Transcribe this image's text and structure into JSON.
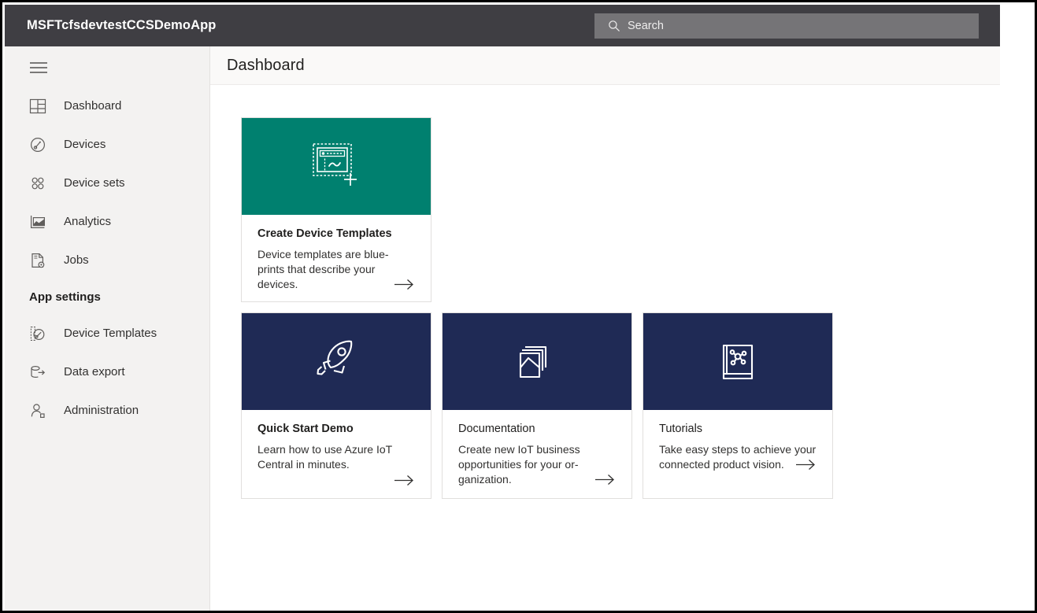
{
  "topbar": {
    "app_title": "MSFTcfsdevtestCCSDemoApp",
    "search_placeholder": "Search",
    "search_value": "",
    "background_color": "#3f3e43",
    "search_background_color": "#757477"
  },
  "sidebar": {
    "menu_toggle_name": "hamburger-menu",
    "background_color": "#f3f2f1",
    "items": [
      {
        "label": "Dashboard",
        "icon": "dashboard-grid-icon"
      },
      {
        "label": "Devices",
        "icon": "device-gauge-icon"
      },
      {
        "label": "Device sets",
        "icon": "device-sets-circles-icon"
      },
      {
        "label": "Analytics",
        "icon": "analytics-chart-icon"
      },
      {
        "label": "Jobs",
        "icon": "jobs-document-gear-icon"
      }
    ],
    "section_label": "App settings",
    "settings_items": [
      {
        "label": "Device Templates",
        "icon": "device-templates-icon"
      },
      {
        "label": "Data export",
        "icon": "data-export-icon"
      },
      {
        "label": "Administration",
        "icon": "administration-person-icon"
      }
    ]
  },
  "page": {
    "title": "Dashboard"
  },
  "cards": {
    "featured": {
      "title": "Create Device Templates",
      "description": "Device templates are blue-prints that describe your devices.",
      "banner_color": "#00806f",
      "icon": "create-device-template-icon",
      "arrow": "arrow-right-icon"
    },
    "items": [
      {
        "title": "Quick Start Demo",
        "description": "Learn how to use Azure IoT Central in minutes.",
        "banner_color": "#1f2a55",
        "icon": "rocket-icon",
        "arrow": "arrow-right-icon"
      },
      {
        "title": "Documentation",
        "description": "Create new IoT business opportunities for your or-ganization.",
        "banner_color": "#1f2a55",
        "icon": "documents-stack-icon",
        "arrow": "arrow-right-icon"
      },
      {
        "title": "Tutorials",
        "description": "Take easy steps to achieve your connected product vision.",
        "banner_color": "#1f2a55",
        "icon": "book-network-icon",
        "arrow": "arrow-right-icon"
      }
    ]
  }
}
